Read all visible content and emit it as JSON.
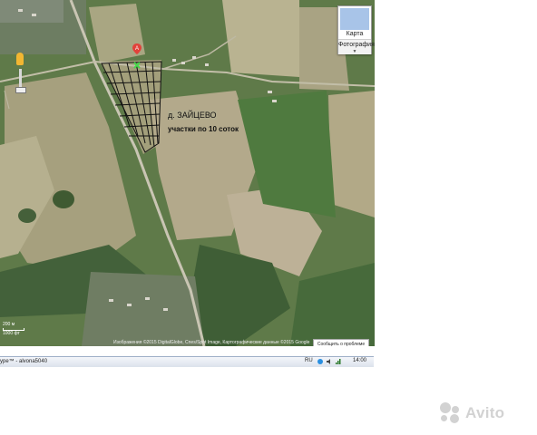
{
  "map": {
    "type_control": {
      "map_label": "Карта",
      "satellite_label": "Фотография"
    },
    "village_label": "д. ЗАЙЦЕВО",
    "plots_label": "участки по 10 соток",
    "marker_letter": "A",
    "scale": {
      "top": "200 м",
      "bottom": "1000 фт"
    },
    "attribution": "Изображения ©2015 DigitalGlobe, Cnes/Spot Image, Картографические данные ©2015 Google",
    "report_button": "Сообщить о проблеме"
  },
  "window": {
    "title": "ype™ - alvona5040"
  },
  "taskbar": {
    "language": "RU",
    "clock": "14:00"
  },
  "watermark": {
    "brand": "Avito"
  }
}
